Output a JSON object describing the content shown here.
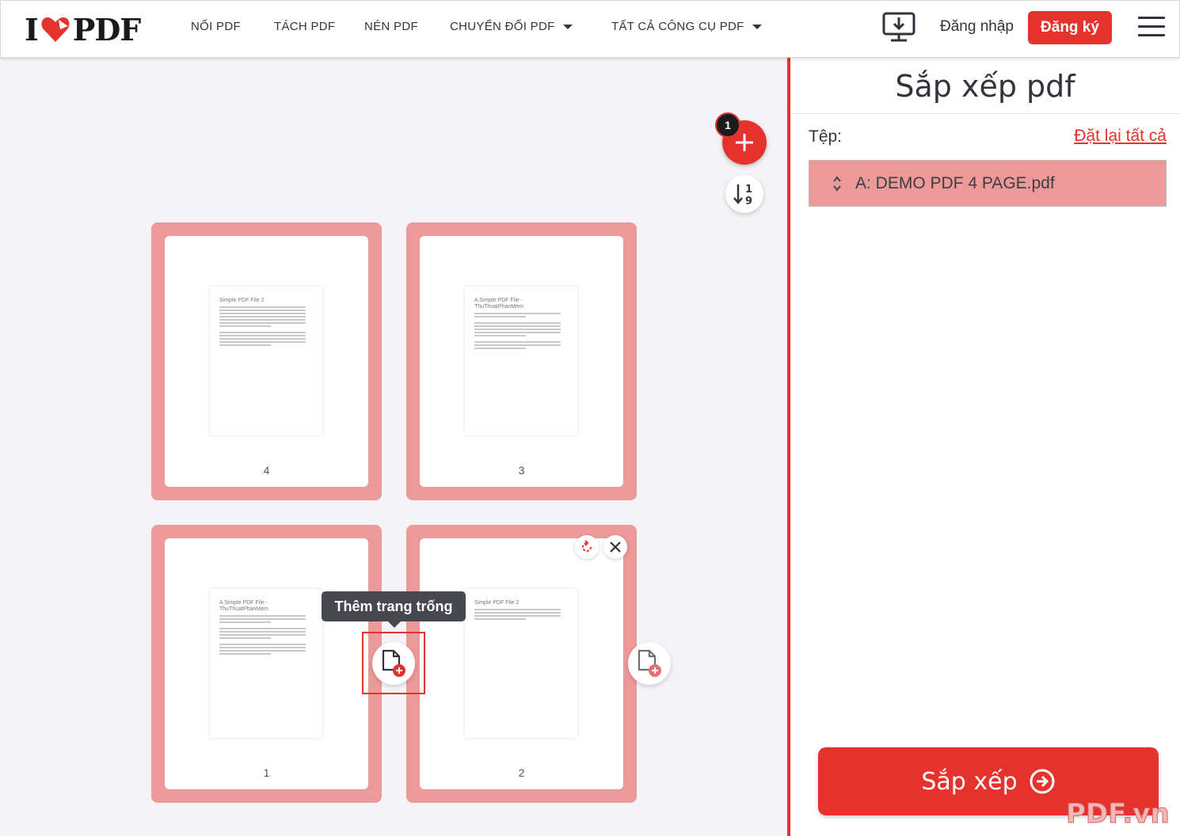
{
  "header": {
    "logo_left": "I",
    "logo_right": "PDF",
    "nav": [
      {
        "label": "NỐI PDF"
      },
      {
        "label": "TÁCH PDF"
      },
      {
        "label": "NÉN PDF"
      },
      {
        "label": "CHUYỂN ĐỔI PDF"
      },
      {
        "label": "TẤT CẢ CÔNG CỤ PDF"
      }
    ],
    "login": "Đăng nhập",
    "signup": "Đăng ký"
  },
  "workspace": {
    "file_count_badge": "1",
    "sort_icon_digits": [
      "1",
      "9"
    ],
    "tooltip": "Thêm trang trống",
    "pages": [
      {
        "number": "4",
        "thumb_title": "Simple PDF File 2",
        "lines": [
          7,
          0,
          5
        ]
      },
      {
        "number": "3",
        "thumb_title": "A Simple PDF File - ThuThuatPhanMem",
        "lines": [
          2,
          0,
          5,
          0,
          3
        ]
      },
      {
        "number": "1",
        "thumb_title": "A Simple PDF File - ThuThuatPhanMem",
        "lines": [
          3,
          0,
          4,
          0,
          4
        ]
      },
      {
        "number": "2",
        "thumb_title": "Simple PDF File 2",
        "lines": [
          4
        ]
      }
    ]
  },
  "sidebar": {
    "title": "Sắp xếp pdf",
    "files_label": "Tệp:",
    "reset": "Đặt lại tất cả",
    "file": "A: DEMO PDF 4 PAGE.pdf",
    "action": "Sắp xếp"
  },
  "watermark": "PDF.vn",
  "colors": {
    "brand_red": "#e5322d",
    "card_pink": "#ec9a99",
    "background": "#f4f4f8"
  }
}
